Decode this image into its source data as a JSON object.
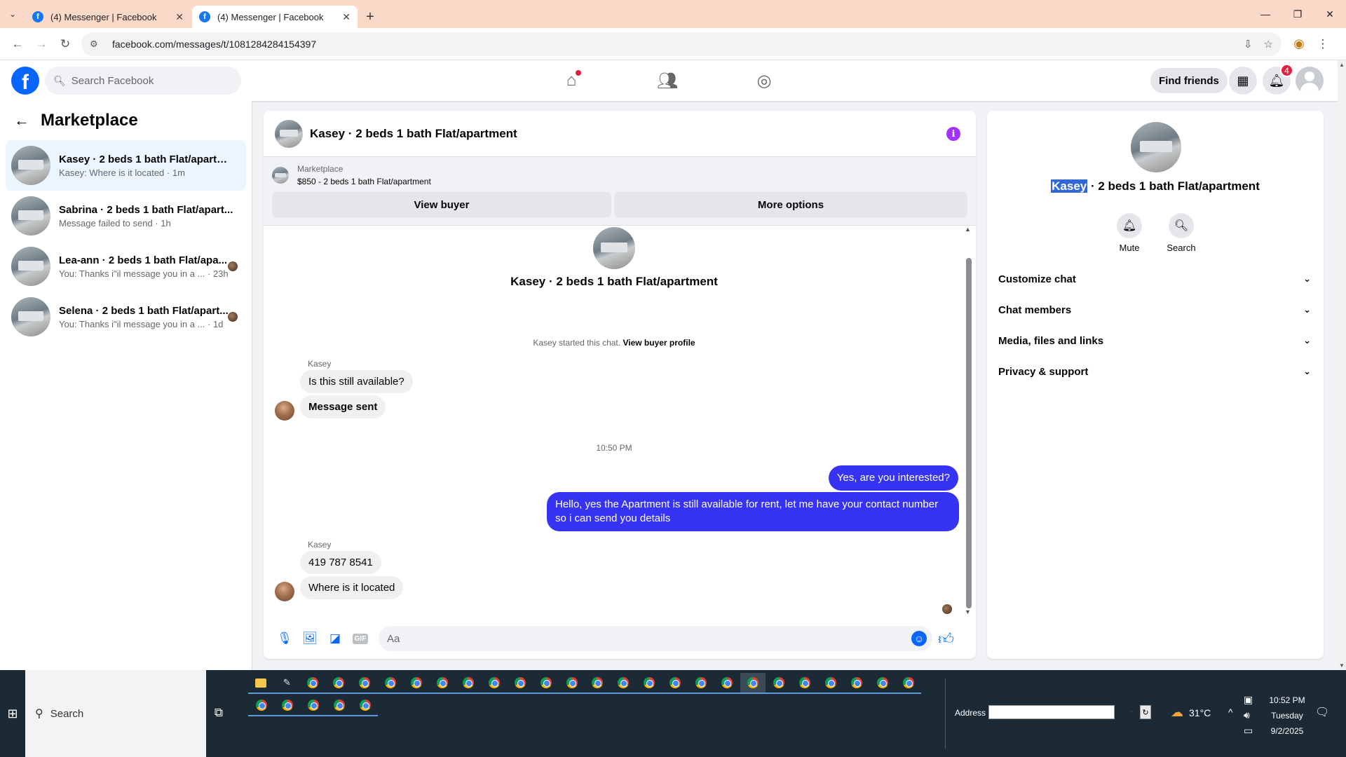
{
  "browser": {
    "tabs": [
      {
        "title": "(4) Messenger | Facebook",
        "active": false
      },
      {
        "title": "(4) Messenger | Facebook",
        "active": true
      }
    ],
    "url": "facebook.com/messages/t/1081284284154397"
  },
  "fb_header": {
    "logo": "f",
    "search_placeholder": "Search Facebook",
    "nav_icons": [
      "home-icon",
      "friends-icon",
      "groups-icon"
    ],
    "find_friends": "Find friends",
    "notification_count": "4"
  },
  "sidebar": {
    "title": "Marketplace",
    "conversations": [
      {
        "name": "Kasey · 2 beds 1 bath Flat/apartment",
        "preview": "Kasey: Where is it located · 1m",
        "active": true
      },
      {
        "name": "Sabrina · 2 beds 1 bath Flat/apart...",
        "preview": "Message failed to send · 1h",
        "active": false
      },
      {
        "name": "Lea-ann · 2 beds 1 bath Flat/apa...",
        "preview": "You: Thanks i\"il message you in a ... · 23h",
        "active": false
      },
      {
        "name": "Selena · 2 beds 1 bath Flat/apart...",
        "preview": "You: Thanks i\"il message you in a ... · 1d",
        "active": false
      }
    ]
  },
  "chat": {
    "title": "Kasey · 2 beds 1 bath Flat/apartment",
    "marketplace_label": "Marketplace",
    "listing": "$850 - 2 beds 1 bath Flat/apartment",
    "view_buyer": "View buyer",
    "more_options": "More options",
    "intro_title": "Kasey · 2 beds 1 bath Flat/apartment",
    "started_text": "Kasey started this chat.",
    "view_buyer_profile": "View buyer profile",
    "sender_1": "Kasey",
    "msg_1": "Is this still available?",
    "msg_2": "Message sent",
    "timestamp": "10:50 PM",
    "out_1": "Yes, are you interested?",
    "out_2": "Hello, yes the Apartment is still available for rent, let me have your contact number so i can send you details",
    "sender_2": "Kasey",
    "msg_3": "419 787 8541",
    "msg_4": "Where is it located",
    "composer_placeholder": "Aa"
  },
  "right_panel": {
    "title_highlight": "Kasey",
    "title_rest": " · 2 beds 1 bath Flat/apartment",
    "mute": "Mute",
    "search": "Search",
    "sections": [
      "Customize chat",
      "Chat members",
      "Media, files and links",
      "Privacy & support"
    ]
  },
  "taskbar": {
    "search": "Search",
    "address_label": "Address",
    "temperature": "31°C",
    "time": "10:52 PM",
    "day": "Tuesday",
    "date": "9/2/2025"
  }
}
